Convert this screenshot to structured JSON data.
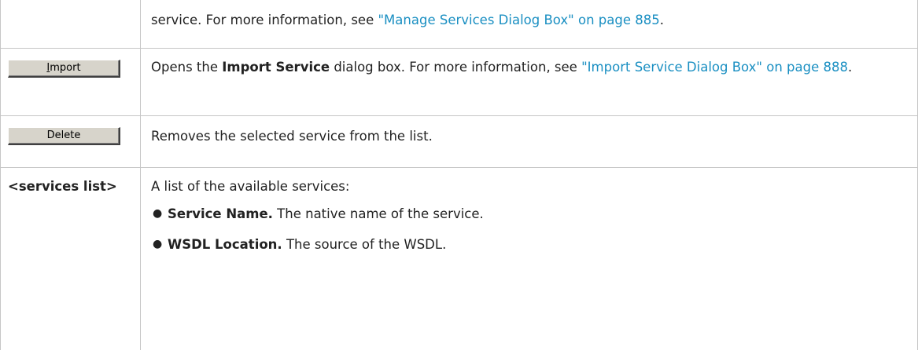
{
  "rows": {
    "r1": {
      "text_before": "service. For more information, see ",
      "link": "\"Manage Services Dialog Box\" on page 885",
      "text_after": "."
    },
    "r2": {
      "button": {
        "underline_char": "I",
        "rest": "mport"
      },
      "text_before": "Opens the ",
      "bold": "Import Service",
      "text_mid": " dialog box. For more information, see ",
      "link": "\"Import Service Dialog Box\" on page 888",
      "text_after": "."
    },
    "r3": {
      "button": {
        "label": "Delete"
      },
      "text": "Removes the selected service from the list."
    },
    "r4": {
      "term": "<services list>",
      "intro": "A list of the available services:",
      "items": [
        {
          "bullet": "●",
          "name": "Service Name.",
          "desc": " The native name of the service."
        },
        {
          "bullet": "●",
          "name": "WSDL Location.",
          "desc": " The source of the WSDL."
        }
      ]
    }
  },
  "colors": {
    "link": "#1a8fc2",
    "border": "#c6c6c6",
    "button_face": "#d7d4cb"
  }
}
